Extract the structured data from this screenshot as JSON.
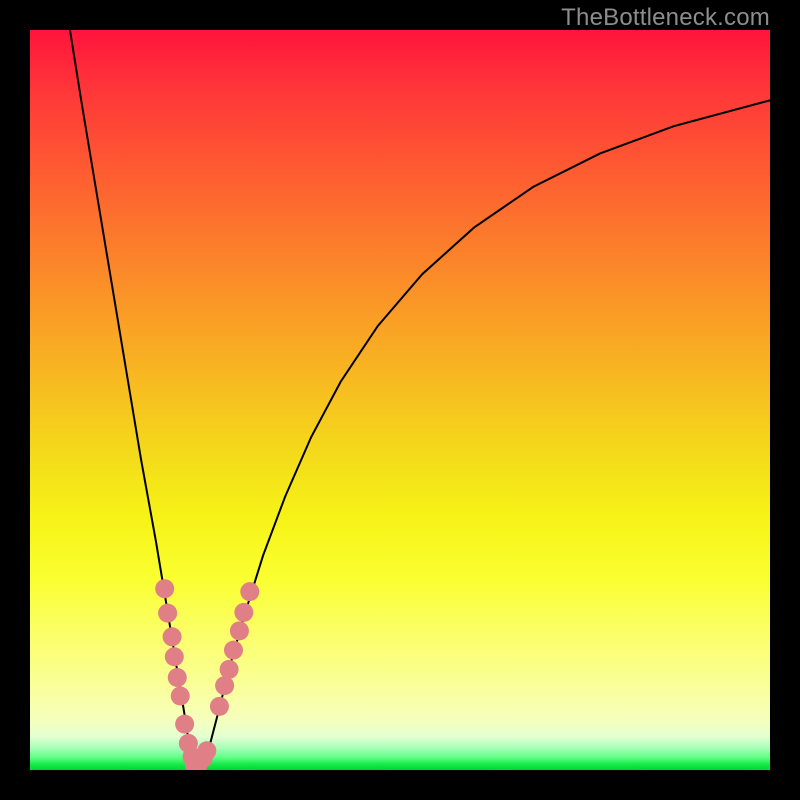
{
  "watermark": "TheBottleneck.com",
  "colors": {
    "frame": "#000000",
    "curve": "#000000",
    "marker": "#e07f85",
    "gradient_top": "#ff143c",
    "gradient_bottom": "#00d631"
  },
  "chart_data": {
    "type": "line",
    "title": "",
    "xlabel": "",
    "ylabel": "",
    "xlim": [
      0,
      100
    ],
    "ylim": [
      0,
      100
    ],
    "series": [
      {
        "name": "bottleneck-curve",
        "x": [
          5.4,
          7,
          9,
          11,
          13,
          15,
          17,
          18.5,
          19.8,
          20.8,
          21.5,
          22.3,
          23.2,
          24.2,
          25.5,
          27,
          29,
          31.5,
          34.5,
          38,
          42,
          47,
          53,
          60,
          68,
          77,
          87,
          100
        ],
        "y": [
          100,
          90,
          78,
          66,
          54,
          42,
          31,
          22,
          14,
          8,
          3.5,
          0.8,
          0.6,
          3,
          8,
          14,
          21,
          29,
          37,
          45,
          52.5,
          60,
          67,
          73.3,
          78.8,
          83.3,
          87,
          90.5
        ]
      }
    ],
    "markers": [
      {
        "x": 18.2,
        "y": 24.5
      },
      {
        "x": 18.6,
        "y": 21.2
      },
      {
        "x": 19.2,
        "y": 18.0
      },
      {
        "x": 19.5,
        "y": 15.3
      },
      {
        "x": 19.9,
        "y": 12.5
      },
      {
        "x": 20.3,
        "y": 10.0
      },
      {
        "x": 20.9,
        "y": 6.2
      },
      {
        "x": 21.4,
        "y": 3.6
      },
      {
        "x": 21.9,
        "y": 1.8
      },
      {
        "x": 22.2,
        "y": 0.7
      },
      {
        "x": 22.7,
        "y": 0.7
      },
      {
        "x": 23.4,
        "y": 1.6
      },
      {
        "x": 23.9,
        "y": 2.6
      },
      {
        "x": 25.6,
        "y": 8.6
      },
      {
        "x": 26.3,
        "y": 11.4
      },
      {
        "x": 26.9,
        "y": 13.6
      },
      {
        "x": 27.5,
        "y": 16.2
      },
      {
        "x": 28.3,
        "y": 18.8
      },
      {
        "x": 28.9,
        "y": 21.3
      },
      {
        "x": 29.7,
        "y": 24.1
      }
    ]
  }
}
